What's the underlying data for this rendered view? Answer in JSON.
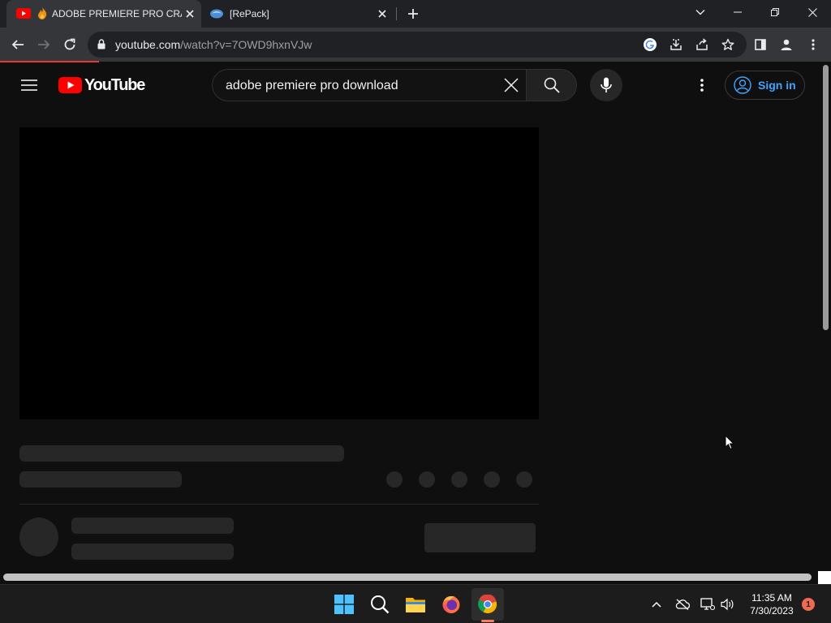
{
  "browser": {
    "tabs": [
      {
        "title": "ADOBE PREMIERE PRO CRACK"
      },
      {
        "title": "[RePack]"
      }
    ],
    "url_host": "youtube.com",
    "url_path": "/watch?v=7OWD9hxnVJw"
  },
  "youtube": {
    "logo_text": "YouTube",
    "search_query": "adobe premiere pro download",
    "signin_label": "Sign in"
  },
  "taskbar": {
    "time": "11:35 AM",
    "date": "7/30/2023",
    "notification_count": "1"
  },
  "colors": {
    "youtube_red": "#ff0000",
    "signin_blue": "#3ea6ff",
    "page_bg": "#0f0f0f"
  }
}
